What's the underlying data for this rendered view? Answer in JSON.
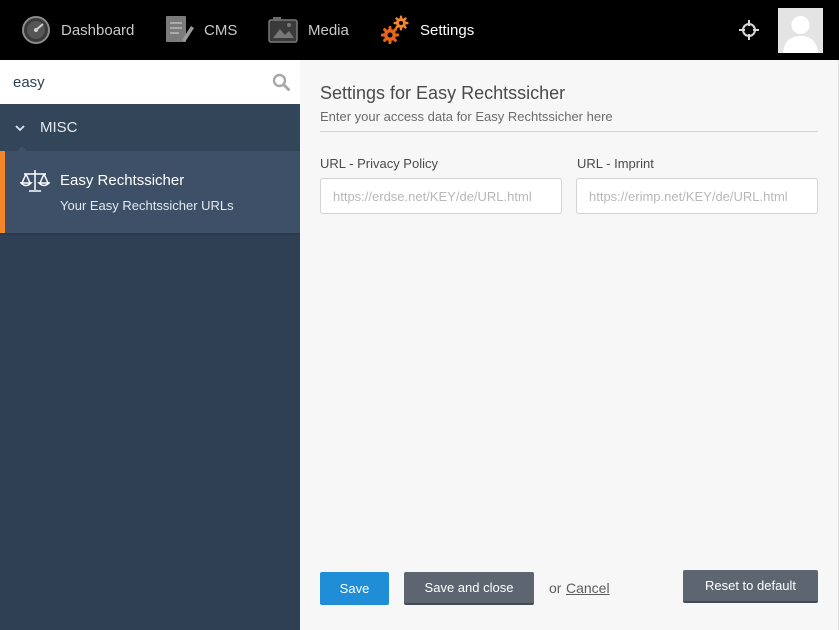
{
  "topnav": {
    "items": [
      {
        "label": "Dashboard",
        "icon": "speedometer-icon"
      },
      {
        "label": "CMS",
        "icon": "document-edit-icon"
      },
      {
        "label": "Media",
        "icon": "image-icon"
      },
      {
        "label": "Settings",
        "icon": "gears-icon",
        "active": true
      }
    ],
    "right_icons": [
      "crosshair-icon",
      "avatar"
    ]
  },
  "sidebar": {
    "search": {
      "value": "easy"
    },
    "section": {
      "title": "MISC"
    },
    "entry": {
      "title": "Easy Rechtssicher",
      "subtitle": "Your Easy Rechtssicher URLs",
      "icon": "scale-icon"
    }
  },
  "main": {
    "title": "Settings for Easy Rechtssicher",
    "subtitle": "Enter your access data for Easy Rechtssicher here",
    "fields": {
      "privacy": {
        "label": "URL - Privacy Policy",
        "placeholder": "https://erdse.net/KEY/de/URL.html"
      },
      "imprint": {
        "label": "URL - Imprint",
        "placeholder": "https://erimp.net/KEY/de/URL.html"
      }
    },
    "buttons": {
      "save": "Save",
      "save_close": "Save and close",
      "or": "or",
      "cancel": "Cancel",
      "reset": "Reset to default"
    }
  },
  "colors": {
    "accent_orange": "#f4872a",
    "primary_blue": "#1f8ed6",
    "sidebar_bg": "#2f4054"
  }
}
